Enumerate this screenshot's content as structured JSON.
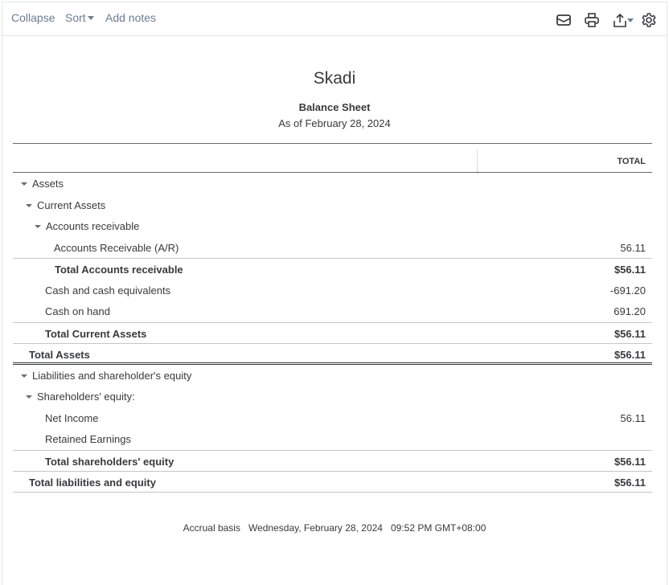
{
  "toolbar": {
    "collapse": "Collapse",
    "sort": "Sort",
    "add_notes": "Add notes"
  },
  "header": {
    "company": "Skadi",
    "report_title": "Balance Sheet",
    "as_of": "As of February 28, 2024"
  },
  "table": {
    "column": "TOTAL",
    "rows": [
      {
        "label": "Assets",
        "value": "",
        "depth": 0,
        "type": "group"
      },
      {
        "label": "Current Assets",
        "value": "",
        "depth": 1,
        "type": "group"
      },
      {
        "label": "Accounts receivable",
        "value": "",
        "depth": 2,
        "type": "group"
      },
      {
        "label": "Accounts Receivable (A/R)",
        "value": "56.11",
        "depth": 3,
        "type": "item"
      },
      {
        "label": "Total Accounts receivable",
        "value": "$56.11",
        "depth": 3,
        "type": "total"
      },
      {
        "label": "Cash and cash equivalents",
        "value": "-691.20",
        "depth": 2,
        "type": "item"
      },
      {
        "label": "Cash on hand",
        "value": "691.20",
        "depth": 2,
        "type": "item"
      },
      {
        "label": "Total Current Assets",
        "value": "$56.11",
        "depth": 2,
        "type": "total"
      },
      {
        "label": "Total Assets",
        "value": "$56.11",
        "depth": 1,
        "type": "total-dbl"
      },
      {
        "label": "Liabilities and shareholder's equity",
        "value": "",
        "depth": 0,
        "type": "group"
      },
      {
        "label": "Shareholders' equity:",
        "value": "",
        "depth": 1,
        "type": "group"
      },
      {
        "label": "Net Income",
        "value": "56.11",
        "depth": 2,
        "type": "item"
      },
      {
        "label": "Retained Earnings",
        "value": "",
        "depth": 2,
        "type": "item"
      },
      {
        "label": "Total shareholders' equity",
        "value": "$56.11",
        "depth": 2,
        "type": "total"
      },
      {
        "label": "Total liabilities and equity",
        "value": "$56.11",
        "depth": 1,
        "type": "total-grand"
      }
    ]
  },
  "footer": {
    "text": "Accrual basis   Wednesday, February 28, 2024   09:52 PM GMT+08:00"
  }
}
